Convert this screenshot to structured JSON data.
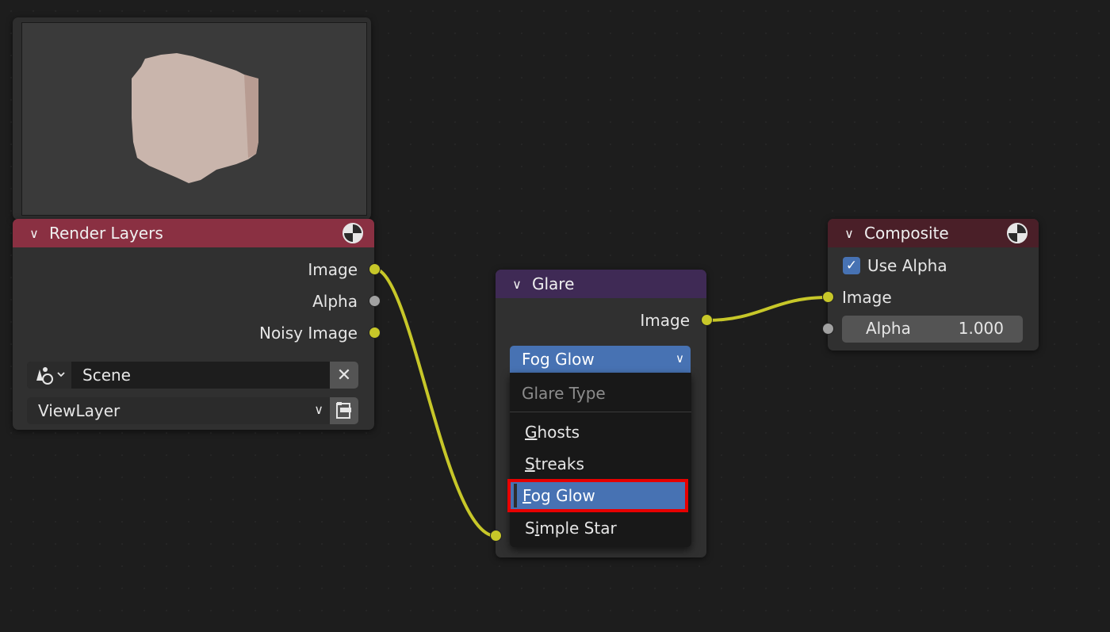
{
  "preview": {
    "icon": "cube-render-preview"
  },
  "render_layers": {
    "title": "Render Layers",
    "header_color": "#8a3042",
    "outputs": [
      "Image",
      "Alpha",
      "Noisy Image"
    ],
    "scene": "Scene",
    "view_layer": "ViewLayer",
    "icons": [
      "scene-icon",
      "close-icon",
      "view-layer-icon",
      "render-icon"
    ]
  },
  "glare": {
    "title": "Glare",
    "header_color": "#3f2a55",
    "output": "Image",
    "selected": "Fog Glow",
    "dropdown": {
      "heading": "Glare Type",
      "options": [
        {
          "pre": "",
          "u": "G",
          "post": "hosts"
        },
        {
          "pre": "",
          "u": "S",
          "post": "treaks"
        },
        {
          "pre": "",
          "u": "F",
          "post": "og Glow"
        },
        {
          "pre": "S",
          "u": "i",
          "post": "mple Star"
        }
      ],
      "highlighted_index": 2,
      "highlight_border": "#e60000"
    }
  },
  "composite": {
    "title": "Composite",
    "header_color": "#4a1f28",
    "use_alpha_label": "Use Alpha",
    "use_alpha_checked": true,
    "input_image": "Image",
    "alpha_label": "Alpha",
    "alpha_value": "1.000"
  },
  "colors": {
    "wire": "#c7c729",
    "selection_blue": "#4772b3"
  }
}
